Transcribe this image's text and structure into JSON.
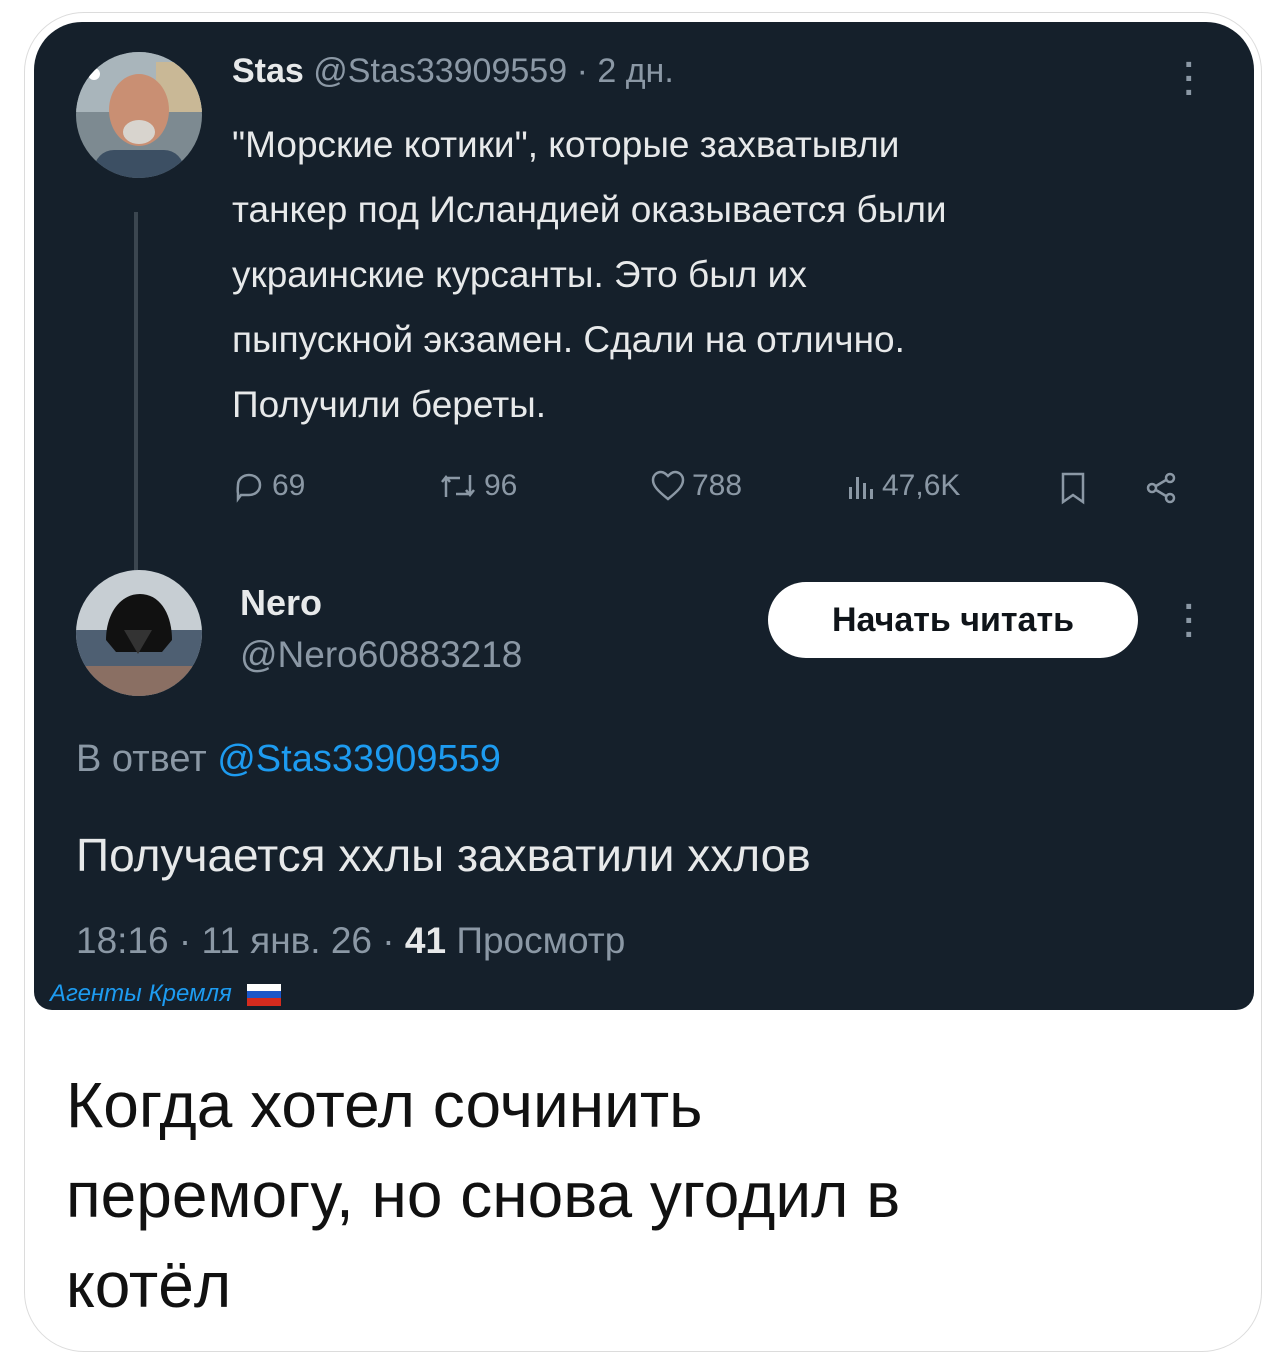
{
  "tweet1": {
    "display_name": "Stas",
    "handle": "@Stas33909559",
    "separator": "·",
    "time_ago": "2 дн.",
    "text_lines": [
      "\"Морские котики\", которые захватывли",
      "танкер под Исландией оказывается были",
      "украинские курсанты. Это был их",
      "пыпускной экзамен. Сдали на отлично.",
      "Получили береты."
    ],
    "actions": {
      "replies": "69",
      "retweets": "96",
      "likes": "788",
      "views": "47,6K"
    }
  },
  "tweet2": {
    "display_name": "Nero",
    "handle": "@Nero60883218",
    "follow_label": "Начать читать",
    "reply_prefix": "В ответ",
    "reply_to": "@Stas33909559",
    "text": "Получается ххлы захватили ххлов",
    "time": "18:16",
    "date": "11 янв. 26",
    "views_count": "41",
    "views_label": "Просмотр"
  },
  "watermark": "Агенты Кремля",
  "caption_lines": [
    "Когда хотел сочинить",
    "перемогу, но снова угодил в",
    "котёл"
  ],
  "colors": {
    "card_bg": "#15202b",
    "text_primary": "#e7e9ea",
    "text_muted": "#8b98a5",
    "link": "#1d9bf0"
  }
}
